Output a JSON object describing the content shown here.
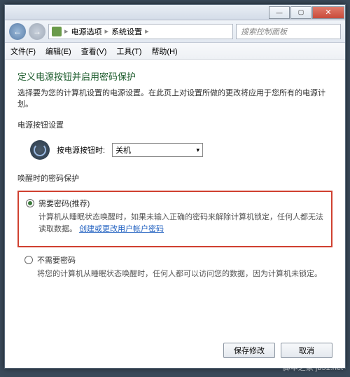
{
  "titlebar": {
    "min": "—",
    "max": "▢",
    "close": "✕"
  },
  "nav": {
    "back": "←",
    "fwd": "→"
  },
  "breadcrumb": {
    "sep1": "▸",
    "item1": "电源选项",
    "sep2": "▸",
    "item2": "系统设置",
    "sep3": "▸"
  },
  "search": {
    "placeholder": "搜索控制面板"
  },
  "menu": {
    "file": "文件(F)",
    "edit": "编辑(E)",
    "view": "查看(V)",
    "tools": "工具(T)",
    "help": "帮助(H)"
  },
  "heading": "定义电源按钮并启用密码保护",
  "subtext": "选择要为您的计算机设置的电源设置。在此页上对设置所做的更改将应用于您所有的电源计划。",
  "section1": "电源按钮设置",
  "powerbtn": {
    "label": "按电源按钮时:",
    "value": "关机"
  },
  "section2": "唤醒时的密码保护",
  "opt1": {
    "title": "需要密码(推荐)",
    "desc_a": "计算机从睡眠状态唤醒时，如果未输入正确的密码来解除计算机锁定，任何人都无法读取数据。",
    "link": "创建或更改用户帐户密码"
  },
  "opt2": {
    "title": "不需要密码",
    "desc": "将您的计算机从睡眠状态唤醒时，任何人都可以访问您的数据，因为计算机未锁定。"
  },
  "buttons": {
    "save": "保存修改",
    "cancel": "取消"
  },
  "watermark": "脚本之家 jb51.net"
}
